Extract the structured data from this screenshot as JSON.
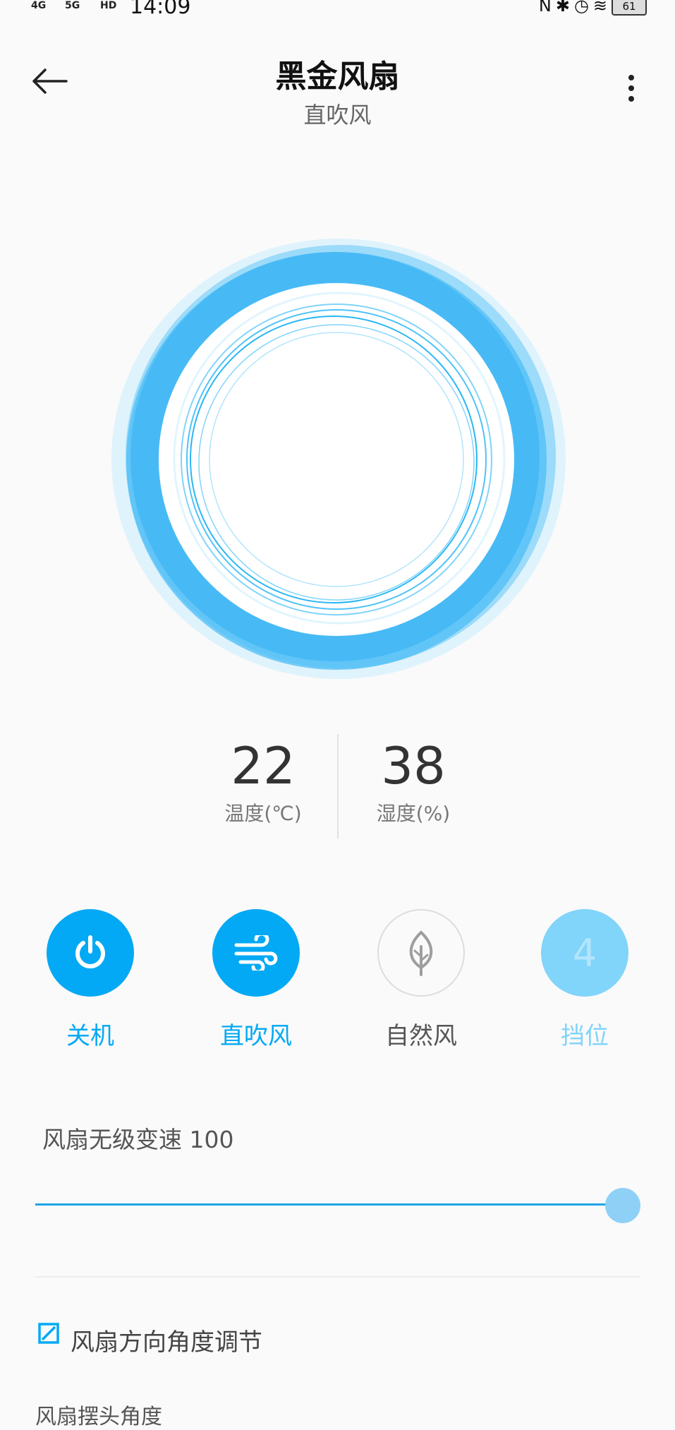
{
  "status_bar": {
    "signal_1": "4G",
    "signal_2": "5G",
    "hd": "HD",
    "time": "14:09",
    "battery": "61",
    "icons": [
      "nfc-icon",
      "bluetooth-icon",
      "alarm-icon",
      "wifi-icon",
      "battery-icon"
    ]
  },
  "header": {
    "title": "黑金风扇",
    "subtitle": "直吹风",
    "back_icon": "arrow-left-icon",
    "more_icon": "more-vertical-icon"
  },
  "readouts": {
    "temperature": {
      "value": "22",
      "label": "温度(℃)"
    },
    "humidity": {
      "value": "38",
      "label": "湿度(%)"
    }
  },
  "controls": [
    {
      "label": "关机",
      "icon": "power-icon",
      "state": "active",
      "color": "#03a9f4"
    },
    {
      "label": "直吹风",
      "icon": "wind-icon",
      "state": "active",
      "color": "#03a9f4"
    },
    {
      "label": "自然风",
      "icon": "leaf-icon",
      "state": "inactive",
      "color": "#9e9e9e"
    },
    {
      "label": "挡位",
      "icon_text": "4",
      "state": "light",
      "color": "#81d4fa"
    }
  ],
  "speed": {
    "label": "风扇无级变速 100",
    "value": 100,
    "max": 100
  },
  "direction": {
    "label": "风扇方向角度调节",
    "icon": "edit-square-icon"
  },
  "angle": {
    "label": "风扇摆头角度"
  },
  "colors": {
    "accent": "#03a9f4",
    "accent_light": "#81d4fa",
    "background": "#fafafa"
  }
}
